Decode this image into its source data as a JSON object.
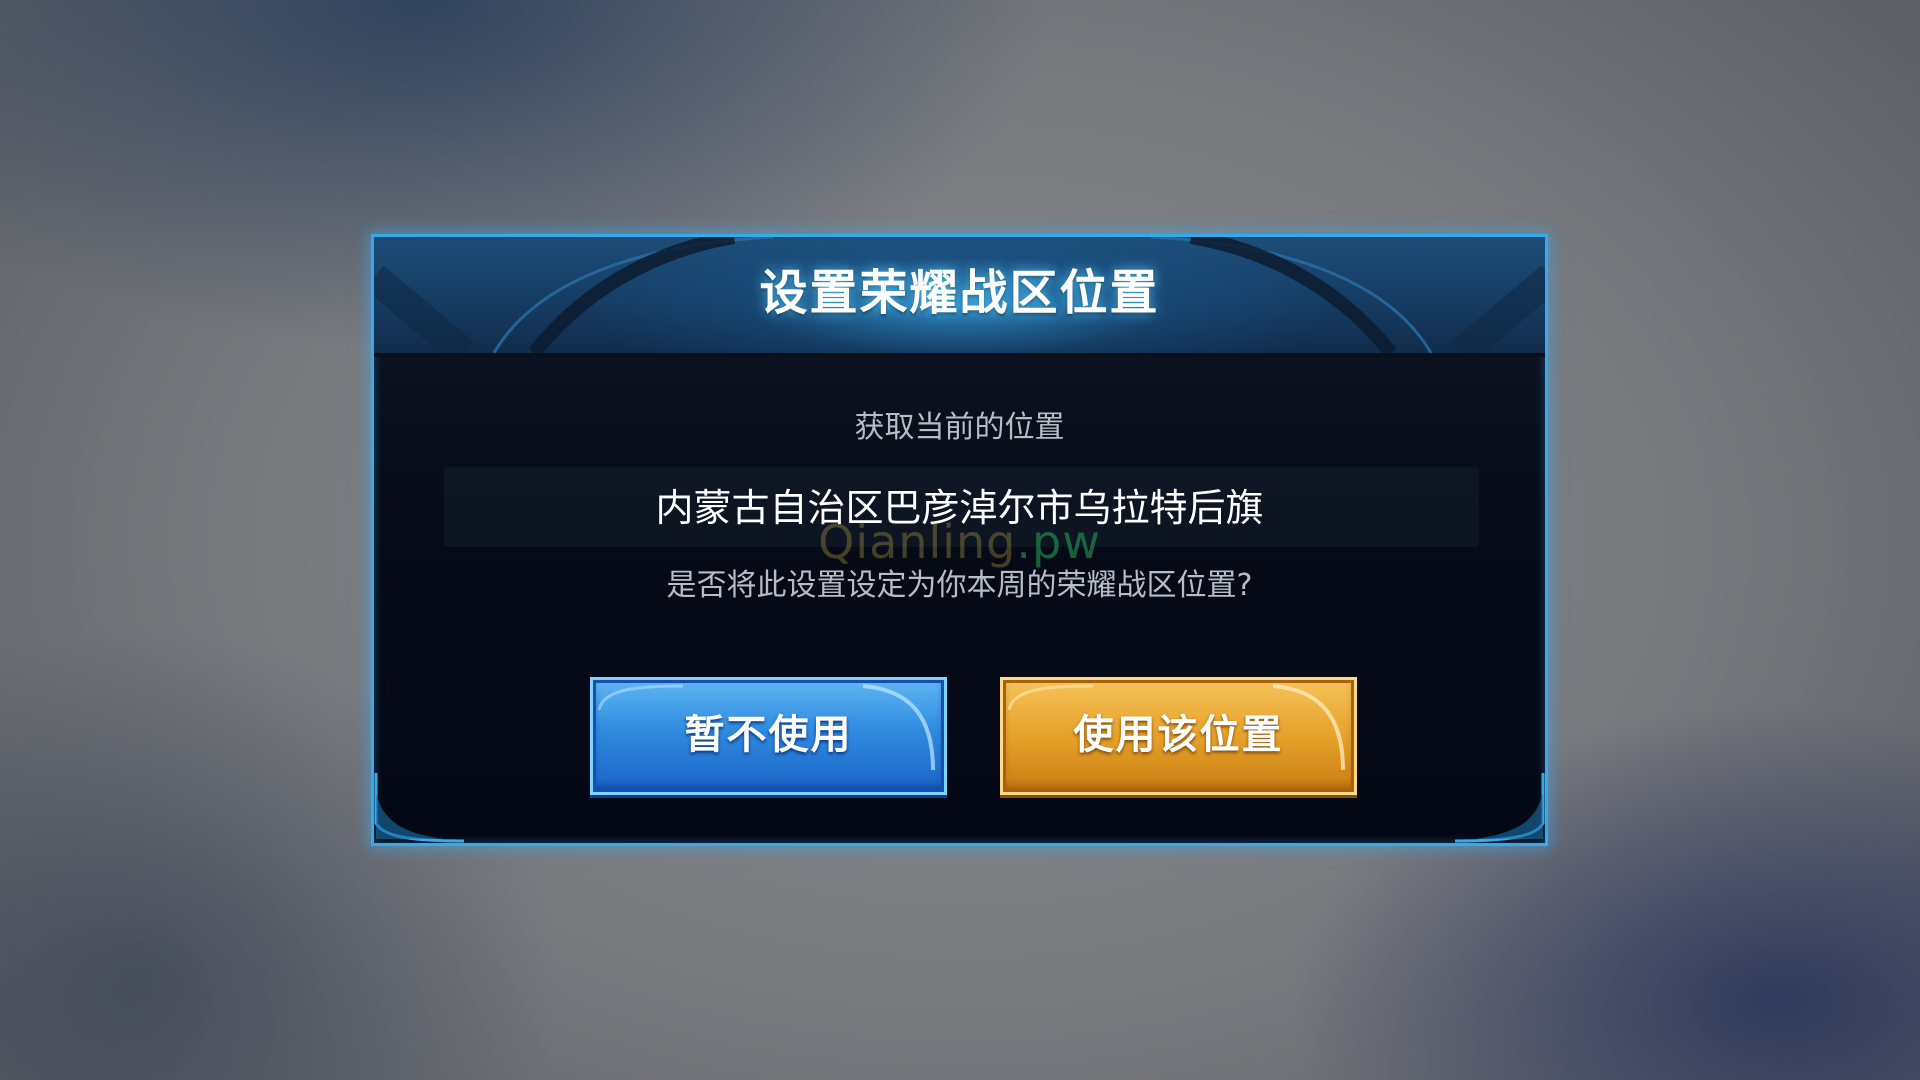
{
  "dialog": {
    "title": "设置荣耀战区位置",
    "subtitle": "获取当前的位置",
    "location": "内蒙古自治区巴彦淖尔市乌拉特后旗",
    "question": "是否将此设置设定为你本周的荣耀战区位置?",
    "watermark_a": "Qianling",
    "watermark_b": ".pw"
  },
  "buttons": {
    "cancel_label": "暂不使用",
    "confirm_label": "使用该位置"
  },
  "colors": {
    "frame": "#3aa9e8",
    "cancel_button": "#2f8be0",
    "confirm_button": "#e6a22a",
    "title_glow": "#50c8ff"
  }
}
